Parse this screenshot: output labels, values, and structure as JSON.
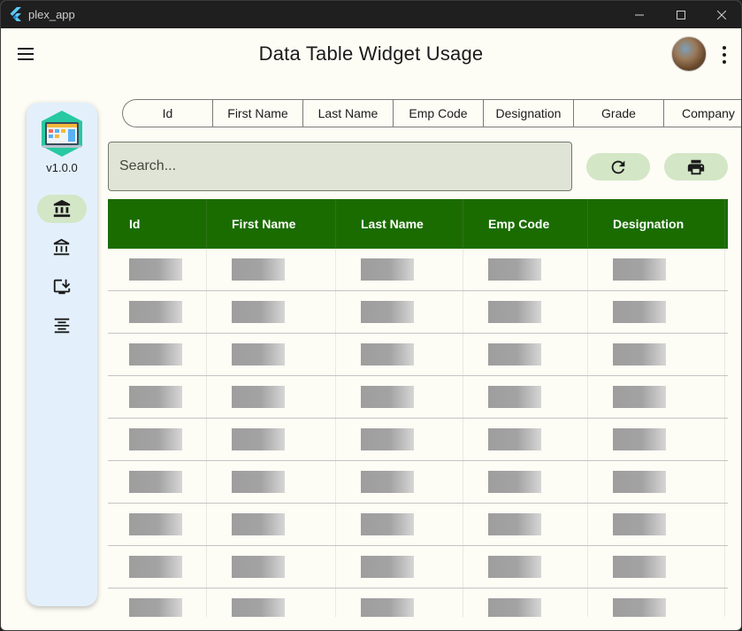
{
  "window": {
    "title": "plex_app",
    "controls": [
      "minimize-icon",
      "maximize-icon",
      "close-icon"
    ]
  },
  "appbar": {
    "title": "Data Table Widget Usage",
    "menu_icon": "hamburger-menu-icon",
    "more_icon": "more-vert-icon"
  },
  "rail": {
    "version": "v1.0.0",
    "items": [
      {
        "icon": "account-balance-icon",
        "active": true
      },
      {
        "icon": "account-balance-icon",
        "active": false
      },
      {
        "icon": "install-desktop-icon",
        "active": false
      },
      {
        "icon": "format-align-center-icon",
        "active": false
      }
    ],
    "active_color": "#d3e6c6",
    "background": "#e3f0fb"
  },
  "column_chips": [
    "Id",
    "First Name",
    "Last Name",
    "Emp Code",
    "Designation",
    "Grade",
    "Company"
  ],
  "search": {
    "placeholder": "Search...",
    "value": ""
  },
  "actions": {
    "refresh_icon": "refresh-icon",
    "print_icon": "print-icon"
  },
  "table": {
    "header_color": "#1a6c00",
    "columns": [
      "Id",
      "First Name",
      "Last Name",
      "Emp Code",
      "Designation"
    ],
    "row_count": 9,
    "rows_state": "loading-shimmer"
  }
}
